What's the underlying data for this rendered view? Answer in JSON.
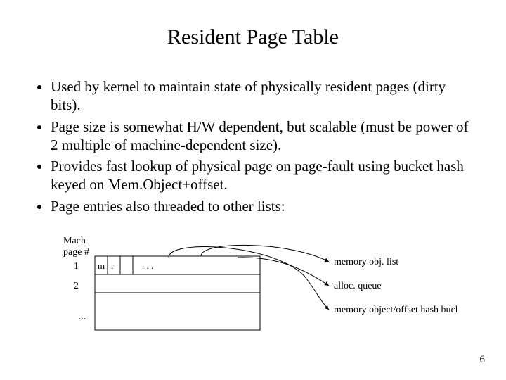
{
  "title": "Resident Page Table",
  "bullets": [
    "Used by kernel to maintain state of physically resident pages (dirty bits).",
    "Page size is somewhat H/W dependent, but scalable (must be power of 2 multiple of machine-dependent size).",
    "Provides fast lookup of physical page on page-fault using bucket hash keyed on Mem.Object+offset.",
    "Page entries also threaded to other lists:"
  ],
  "diagram": {
    "left_header1": "Mach",
    "left_header2": "page #",
    "row_labels": [
      "1",
      "2",
      "..."
    ],
    "cell_m": "m",
    "cell_r": "r",
    "cell_dots": ". . .",
    "right_labels": [
      "memory obj. list",
      "alloc. queue",
      "memory object/offset hash bucket"
    ]
  },
  "page_number": "6"
}
